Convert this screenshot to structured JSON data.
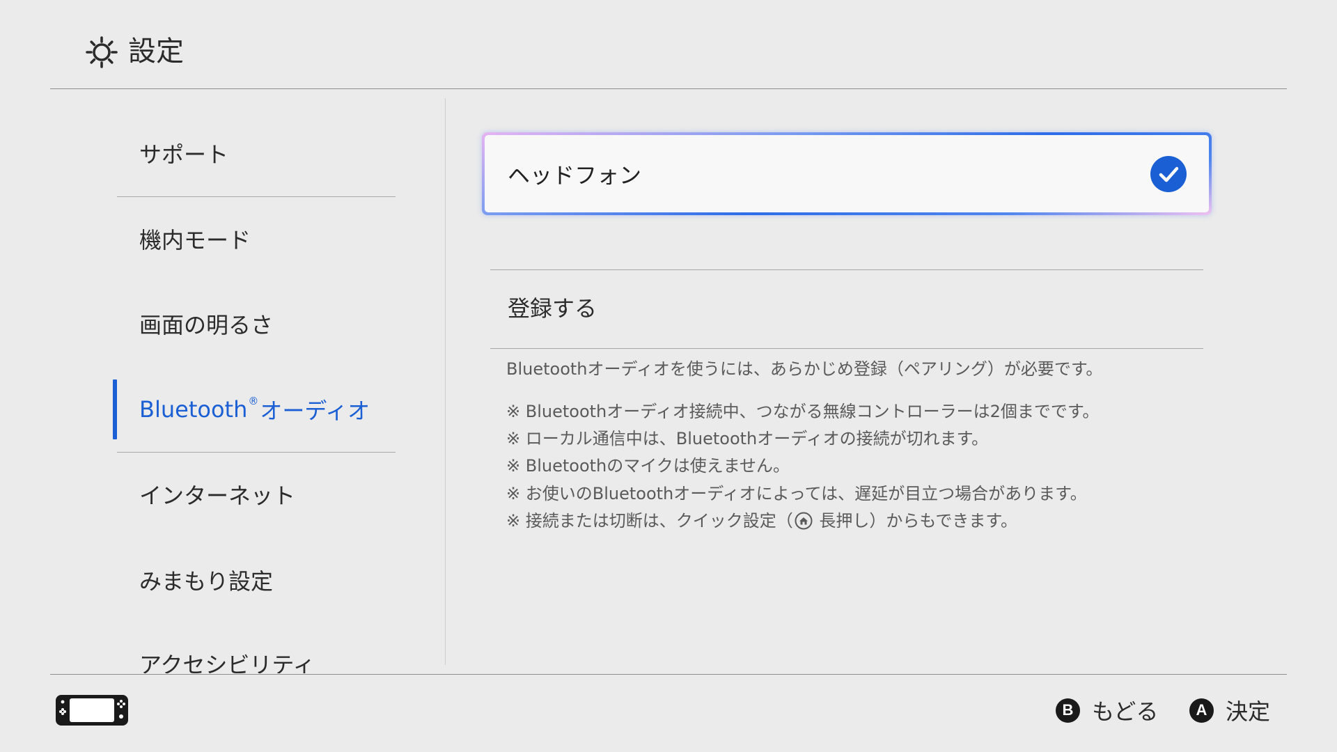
{
  "header": {
    "title": "設定",
    "icon": "gear-icon"
  },
  "sidebar": {
    "items": [
      {
        "label": "サポート"
      },
      {
        "label": "機内モード"
      },
      {
        "label": "画面の明るさ"
      },
      {
        "label": "Bluetooth",
        "sup": "®",
        "suffix": "オーディオ",
        "selected": true
      },
      {
        "label": "インターネット"
      },
      {
        "label": "みまもり設定"
      },
      {
        "label": "アクセシビリティ"
      }
    ]
  },
  "main": {
    "device": {
      "name": "ヘッドフォン",
      "connected": true,
      "status_icon": "check-circle-icon"
    },
    "register_label": "登録する",
    "description": "Bluetoothオーディオを使うには、あらかじめ登録（ペアリング）が必要です。",
    "notes": [
      "※ Bluetoothオーディオ接続中、つながる無線コントローラーは2個までです。",
      "※ ローカル通信中は、Bluetoothオーディオの接続が切れます。",
      "※ Bluetoothのマイクは使えません。",
      "※ お使いのBluetoothオーディオによっては、遅延が目立つ場合があります。"
    ],
    "last_note": {
      "before": "※ 接続または切断は、クイック設定（",
      "icon": "home-button-icon",
      "after": " 長押し）からもできます。"
    }
  },
  "footer": {
    "console_icon": "switch-console-icon",
    "buttons": [
      {
        "key": "B",
        "label": "もどる"
      },
      {
        "key": "A",
        "label": "決定"
      }
    ]
  },
  "colors": {
    "background": "#ebebeb",
    "accent": "#1b5fd4",
    "text": "#2b2b2b",
    "secondary_text": "#5a5a5a"
  }
}
